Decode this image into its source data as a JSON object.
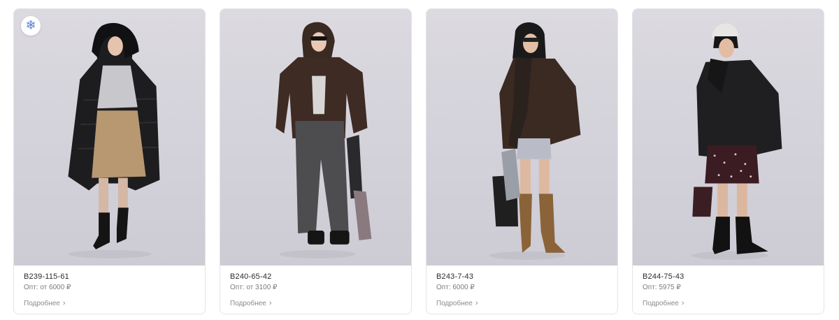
{
  "products": [
    {
      "sku": "B239-115-61",
      "price": "Опт: от 6000 ₽",
      "more_label": "Подробнее",
      "badge_icon": "snowflake-icon"
    },
    {
      "sku": "B240-65-42",
      "price": "Опт: от 3100 ₽",
      "more_label": "Подробнее"
    },
    {
      "sku": "B243-7-43",
      "price": "Опт: 6000 ₽",
      "more_label": "Подробнее"
    },
    {
      "sku": "B244-75-43",
      "price": "Опт: 5975 ₽",
      "more_label": "Подробнее"
    }
  ],
  "colors": {
    "snowflake": "#5b7fd1",
    "border": "#e4e4e7",
    "photo_bg": "#d6d4dc"
  }
}
